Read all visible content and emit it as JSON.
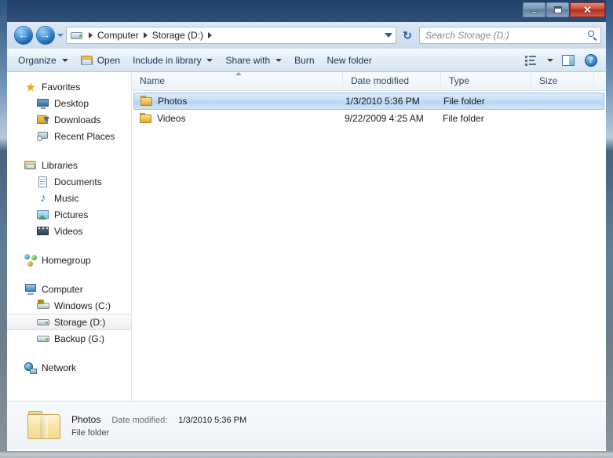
{
  "window": {
    "minimize_label": "Minimize",
    "maximize_label": "Maximize",
    "close_label": "✕"
  },
  "address_bar": {
    "back_arrow": "←",
    "forward_arrow": "→",
    "crumbs": [
      {
        "label": "Computer"
      },
      {
        "label": "Storage (D:)"
      }
    ],
    "refresh_glyph": "↻"
  },
  "search": {
    "placeholder": "Search Storage (D:)",
    "value": ""
  },
  "toolbar": {
    "organize_label": "Organize",
    "open_label": "Open",
    "include_label": "Include in library",
    "share_label": "Share with",
    "burn_label": "Burn",
    "new_folder_label": "New folder",
    "help_glyph": "?"
  },
  "nav_pane": {
    "groups": [
      {
        "header": "Favorites",
        "icon": "star-icon",
        "items": [
          {
            "label": "Desktop",
            "icon": "desktop-icon"
          },
          {
            "label": "Downloads",
            "icon": "downloads-icon"
          },
          {
            "label": "Recent Places",
            "icon": "recent-places-icon"
          }
        ]
      },
      {
        "header": "Libraries",
        "icon": "libraries-icon",
        "items": [
          {
            "label": "Documents",
            "icon": "documents-icon"
          },
          {
            "label": "Music",
            "icon": "music-icon"
          },
          {
            "label": "Pictures",
            "icon": "pictures-icon"
          },
          {
            "label": "Videos",
            "icon": "videos-icon"
          }
        ]
      },
      {
        "header": "Homegroup",
        "icon": "homegroup-icon",
        "items": []
      },
      {
        "header": "Computer",
        "icon": "computer-icon",
        "items": [
          {
            "label": "Windows (C:)",
            "icon": "windows-drive-icon"
          },
          {
            "label": "Storage (D:)",
            "icon": "drive-icon",
            "selected": true
          },
          {
            "label": "Backup (G:)",
            "icon": "drive-icon"
          }
        ]
      },
      {
        "header": "Network",
        "icon": "network-icon",
        "items": []
      }
    ]
  },
  "file_list": {
    "columns": [
      {
        "label": "Name",
        "sorted": "asc"
      },
      {
        "label": "Date modified"
      },
      {
        "label": "Type"
      },
      {
        "label": "Size"
      }
    ],
    "rows": [
      {
        "name": "Photos",
        "date_modified": "1/3/2010 5:36 PM",
        "type": "File folder",
        "size": "",
        "selected": true
      },
      {
        "name": "Videos",
        "date_modified": "9/22/2009 4:25 AM",
        "type": "File folder",
        "size": "",
        "selected": false
      }
    ]
  },
  "status_bar": {
    "name": "Photos",
    "date_label": "Date modified:",
    "date_value": "1/3/2010 5:36 PM",
    "type": "File folder"
  },
  "colors": {
    "titlebar": "#27496f",
    "selection": "#c4ddf6",
    "accent": "#2b6cb0",
    "folder": "#f2c65c"
  }
}
